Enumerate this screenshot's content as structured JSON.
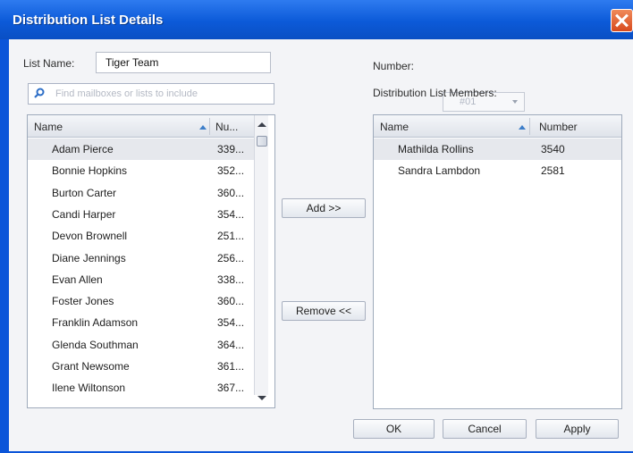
{
  "window": {
    "title": "Distribution List Details"
  },
  "form": {
    "list_name_label": "List Name:",
    "list_name_value": "Tiger Team",
    "search_placeholder": "Find mailboxes or lists to include",
    "number_label": "Number:",
    "number_value": "#01",
    "members_label": "Distribution List Members:"
  },
  "available": {
    "columns": [
      "Name",
      "Nu..."
    ],
    "rows": [
      {
        "name": "Adam Pierce",
        "number": "339..."
      },
      {
        "name": "Bonnie Hopkins",
        "number": "352..."
      },
      {
        "name": "Burton Carter",
        "number": "360..."
      },
      {
        "name": "Candi Harper",
        "number": "354..."
      },
      {
        "name": "Devon Brownell",
        "number": "251..."
      },
      {
        "name": "Diane Jennings",
        "number": "256..."
      },
      {
        "name": "Evan Allen",
        "number": "338..."
      },
      {
        "name": "Foster Jones",
        "number": "360..."
      },
      {
        "name": "Franklin Adamson",
        "number": "354..."
      },
      {
        "name": "Glenda Southman",
        "number": "364..."
      },
      {
        "name": "Grant Newsome",
        "number": "361..."
      },
      {
        "name": "Ilene Wiltonson",
        "number": "367..."
      }
    ]
  },
  "members": {
    "columns": [
      "Name",
      "Number"
    ],
    "rows": [
      {
        "name": "Mathilda Rollins",
        "number": "3540"
      },
      {
        "name": "Sandra Lambdon",
        "number": "2581"
      }
    ]
  },
  "buttons": {
    "add": "Add >>",
    "remove": "Remove <<",
    "ok": "OK",
    "cancel": "Cancel",
    "apply": "Apply"
  },
  "colors": {
    "title_bar": "#0c5ad8",
    "close_button": "#d84a1e",
    "sort_arrow": "#3d7ec9",
    "search_icon": "#2e6fc7"
  },
  "icons": {
    "close": "close-icon",
    "search": "search-icon",
    "sort_ascending": "sort-ascending-icon",
    "scroll_up": "scroll-up-icon",
    "scroll_down": "scroll-down-icon",
    "dropdown": "chevron-down-icon"
  }
}
